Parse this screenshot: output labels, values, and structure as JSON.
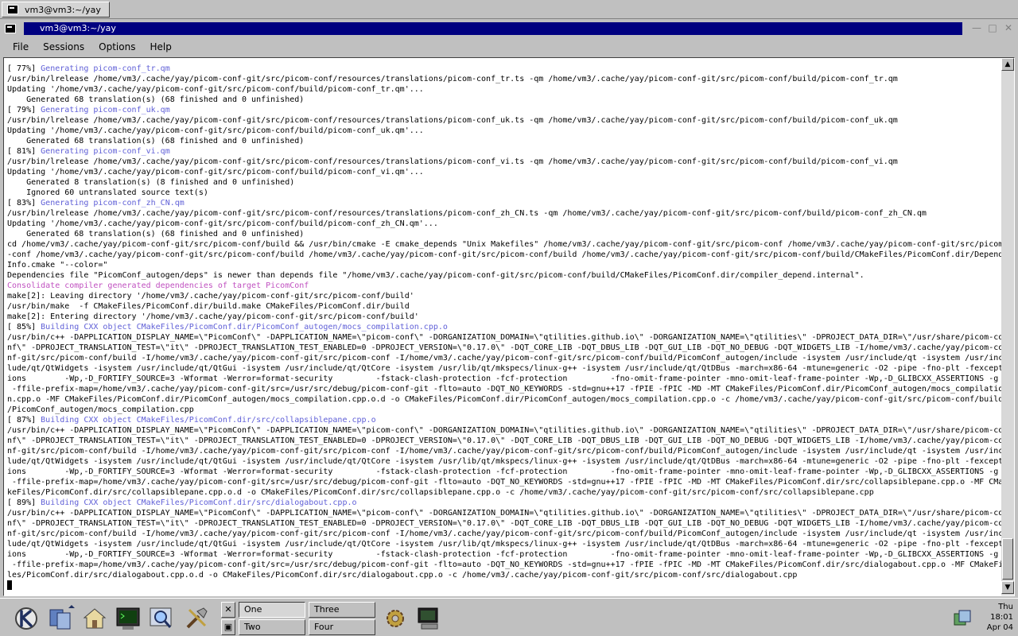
{
  "top_tab": {
    "label": "vm3@vm3:~/yay"
  },
  "window": {
    "title": "vm3@vm3:~/yay"
  },
  "menu": [
    "File",
    "Sessions",
    "Options",
    "Help"
  ],
  "terminal_lines": [
    {
      "t": "[ 77%] ",
      "h": "Generating picom-conf_tr.qm",
      "c": "blue"
    },
    {
      "t": "/usr/bin/lrelease /home/vm3/.cache/yay/picom-conf-git/src/picom-conf/resources/translations/picom-conf_tr.ts -qm /home/vm3/.cache/yay/picom-conf-git/src/picom-conf/build/picom-conf_tr.qm"
    },
    {
      "t": "Updating '/home/vm3/.cache/yay/picom-conf-git/src/picom-conf/build/picom-conf_tr.qm'..."
    },
    {
      "t": "    Generated 68 translation(s) (68 finished and 0 unfinished)"
    },
    {
      "t": "[ 79%] ",
      "h": "Generating picom-conf_uk.qm",
      "c": "blue"
    },
    {
      "t": "/usr/bin/lrelease /home/vm3/.cache/yay/picom-conf-git/src/picom-conf/resources/translations/picom-conf_uk.ts -qm /home/vm3/.cache/yay/picom-conf-git/src/picom-conf/build/picom-conf_uk.qm"
    },
    {
      "t": "Updating '/home/vm3/.cache/yay/picom-conf-git/src/picom-conf/build/picom-conf_uk.qm'..."
    },
    {
      "t": "    Generated 68 translation(s) (68 finished and 0 unfinished)"
    },
    {
      "t": "[ 81%] ",
      "h": "Generating picom-conf_vi.qm",
      "c": "blue"
    },
    {
      "t": "/usr/bin/lrelease /home/vm3/.cache/yay/picom-conf-git/src/picom-conf/resources/translations/picom-conf_vi.ts -qm /home/vm3/.cache/yay/picom-conf-git/src/picom-conf/build/picom-conf_vi.qm"
    },
    {
      "t": "Updating '/home/vm3/.cache/yay/picom-conf-git/src/picom-conf/build/picom-conf_vi.qm'..."
    },
    {
      "t": "    Generated 8 translation(s) (8 finished and 0 unfinished)"
    },
    {
      "t": "    Ignored 60 untranslated source text(s)"
    },
    {
      "t": "[ 83%] ",
      "h": "Generating picom-conf_zh_CN.qm",
      "c": "blue"
    },
    {
      "t": "/usr/bin/lrelease /home/vm3/.cache/yay/picom-conf-git/src/picom-conf/resources/translations/picom-conf_zh_CN.ts -qm /home/vm3/.cache/yay/picom-conf-git/src/picom-conf/build/picom-conf_zh_CN.qm"
    },
    {
      "t": "Updating '/home/vm3/.cache/yay/picom-conf-git/src/picom-conf/build/picom-conf_zh_CN.qm'..."
    },
    {
      "t": "    Generated 68 translation(s) (68 finished and 0 unfinished)"
    },
    {
      "t": "cd /home/vm3/.cache/yay/picom-conf-git/src/picom-conf/build && /usr/bin/cmake -E cmake_depends \"Unix Makefiles\" /home/vm3/.cache/yay/picom-conf-git/src/picom-conf /home/vm3/.cache/yay/picom-conf-git/src/picom"
    },
    {
      "t": "-conf /home/vm3/.cache/yay/picom-conf-git/src/picom-conf/build /home/vm3/.cache/yay/picom-conf-git/src/picom-conf/build /home/vm3/.cache/yay/picom-conf-git/src/picom-conf/build/CMakeFiles/PicomConf.dir/Depend"
    },
    {
      "t": "Info.cmake \"--color=\""
    },
    {
      "t": "Dependencies file \"PicomConf_autogen/deps\" is newer than depends file \"/home/vm3/.cache/yay/picom-conf-git/src/picom-conf/build/CMakeFiles/PicomConf.dir/compiler_depend.internal\"."
    },
    {
      "t": "",
      "h": "Consolidate compiler generated dependencies of target PicomConf",
      "c": "magenta"
    },
    {
      "t": "make[2]: Leaving directory '/home/vm3/.cache/yay/picom-conf-git/src/picom-conf/build'"
    },
    {
      "t": "/usr/bin/make  -f CMakeFiles/PicomConf.dir/build.make CMakeFiles/PicomConf.dir/build"
    },
    {
      "t": "make[2]: Entering directory '/home/vm3/.cache/yay/picom-conf-git/src/picom-conf/build'"
    },
    {
      "t": "[ 85%] ",
      "h": "Building CXX object CMakeFiles/PicomConf.dir/PicomConf_autogen/mocs_compilation.cpp.o",
      "c": "blue"
    },
    {
      "t": "/usr/bin/c++ -DAPPLICATION_DISPLAY_NAME=\\\"PicomConf\\\" -DAPPLICATION_NAME=\\\"picom-conf\\\" -DORGANIZATION_DOMAIN=\\\"qtilities.github.io\\\" -DORGANIZATION_NAME=\\\"qtilities\\\" -DPROJECT_DATA_DIR=\\\"/usr/share/picom-co"
    },
    {
      "t": "nf\\\" -DPROJECT_TRANSLATION_TEST=\\\"it\\\" -DPROJECT_TRANSLATION_TEST_ENABLED=0 -DPROJECT_VERSION=\\\"0.17.0\\\" -DQT_CORE_LIB -DQT_DBUS_LIB -DQT_GUI_LIB -DQT_NO_DEBUG -DQT_WIDGETS_LIB -I/home/vm3/.cache/yay/picom-co"
    },
    {
      "t": "nf-git/src/picom-conf/build -I/home/vm3/.cache/yay/picom-conf-git/src/picom-conf -I/home/vm3/.cache/yay/picom-conf-git/src/picom-conf/build/PicomConf_autogen/include -isystem /usr/include/qt -isystem /usr/inc"
    },
    {
      "t": "lude/qt/QtWidgets -isystem /usr/include/qt/QtGui -isystem /usr/include/qt/QtCore -isystem /usr/lib/qt/mkspecs/linux-g++ -isystem /usr/include/qt/QtDBus -march=x86-64 -mtune=generic -O2 -pipe -fno-plt -fexcept"
    },
    {
      "t": "ions        -Wp,-D_FORTIFY_SOURCE=3 -Wformat -Werror=format-security         -fstack-clash-protection -fcf-protection         -fno-omit-frame-pointer -mno-omit-leaf-frame-pointer -Wp,-D_GLIBCXX_ASSERTIONS -g"
    },
    {
      "t": " -ffile-prefix-map=/home/vm3/.cache/yay/picom-conf-git/src=/usr/src/debug/picom-conf-git -flto=auto -DQT_NO_KEYWORDS -std=gnu++17 -fPIE -fPIC -MD -MT CMakeFiles/PicomConf.dir/PicomConf_autogen/mocs_compilatio"
    },
    {
      "t": "n.cpp.o -MF CMakeFiles/PicomConf.dir/PicomConf_autogen/mocs_compilation.cpp.o.d -o CMakeFiles/PicomConf.dir/PicomConf_autogen/mocs_compilation.cpp.o -c /home/vm3/.cache/yay/picom-conf-git/src/picom-conf/build"
    },
    {
      "t": "/PicomConf_autogen/mocs_compilation.cpp"
    },
    {
      "t": "[ 87%] ",
      "h": "Building CXX object CMakeFiles/PicomConf.dir/src/collapsiblepane.cpp.o",
      "c": "blue"
    },
    {
      "t": "/usr/bin/c++ -DAPPLICATION_DISPLAY_NAME=\\\"PicomConf\\\" -DAPPLICATION_NAME=\\\"picom-conf\\\" -DORGANIZATION_DOMAIN=\\\"qtilities.github.io\\\" -DORGANIZATION_NAME=\\\"qtilities\\\" -DPROJECT_DATA_DIR=\\\"/usr/share/picom-co"
    },
    {
      "t": "nf\\\" -DPROJECT_TRANSLATION_TEST=\\\"it\\\" -DPROJECT_TRANSLATION_TEST_ENABLED=0 -DPROJECT_VERSION=\\\"0.17.0\\\" -DQT_CORE_LIB -DQT_DBUS_LIB -DQT_GUI_LIB -DQT_NO_DEBUG -DQT_WIDGETS_LIB -I/home/vm3/.cache/yay/picom-co"
    },
    {
      "t": "nf-git/src/picom-conf/build -I/home/vm3/.cache/yay/picom-conf-git/src/picom-conf -I/home/vm3/.cache/yay/picom-conf-git/src/picom-conf/build/PicomConf_autogen/include -isystem /usr/include/qt -isystem /usr/inc"
    },
    {
      "t": "lude/qt/QtWidgets -isystem /usr/include/qt/QtGui -isystem /usr/include/qt/QtCore -isystem /usr/lib/qt/mkspecs/linux-g++ -isystem /usr/include/qt/QtDBus -march=x86-64 -mtune=generic -O2 -pipe -fno-plt -fexcept"
    },
    {
      "t": "ions        -Wp,-D_FORTIFY_SOURCE=3 -Wformat -Werror=format-security         -fstack-clash-protection -fcf-protection         -fno-omit-frame-pointer -mno-omit-leaf-frame-pointer -Wp,-D_GLIBCXX_ASSERTIONS -g"
    },
    {
      "t": " -ffile-prefix-map=/home/vm3/.cache/yay/picom-conf-git/src=/usr/src/debug/picom-conf-git -flto=auto -DQT_NO_KEYWORDS -std=gnu++17 -fPIE -fPIC -MD -MT CMakeFiles/PicomConf.dir/src/collapsiblepane.cpp.o -MF CMa"
    },
    {
      "t": "keFiles/PicomConf.dir/src/collapsiblepane.cpp.o.d -o CMakeFiles/PicomConf.dir/src/collapsiblepane.cpp.o -c /home/vm3/.cache/yay/picom-conf-git/src/picom-conf/src/collapsiblepane.cpp"
    },
    {
      "t": "[ 89%] ",
      "h": "Building CXX object CMakeFiles/PicomConf.dir/src/dialogabout.cpp.o",
      "c": "blue"
    },
    {
      "t": "/usr/bin/c++ -DAPPLICATION_DISPLAY_NAME=\\\"PicomConf\\\" -DAPPLICATION_NAME=\\\"picom-conf\\\" -DORGANIZATION_DOMAIN=\\\"qtilities.github.io\\\" -DORGANIZATION_NAME=\\\"qtilities\\\" -DPROJECT_DATA_DIR=\\\"/usr/share/picom-co"
    },
    {
      "t": "nf\\\" -DPROJECT_TRANSLATION_TEST=\\\"it\\\" -DPROJECT_TRANSLATION_TEST_ENABLED=0 -DPROJECT_VERSION=\\\"0.17.0\\\" -DQT_CORE_LIB -DQT_DBUS_LIB -DQT_GUI_LIB -DQT_NO_DEBUG -DQT_WIDGETS_LIB -I/home/vm3/.cache/yay/picom-co"
    },
    {
      "t": "nf-git/src/picom-conf/build -I/home/vm3/.cache/yay/picom-conf-git/src/picom-conf -I/home/vm3/.cache/yay/picom-conf-git/src/picom-conf/build/PicomConf_autogen/include -isystem /usr/include/qt -isystem /usr/inc"
    },
    {
      "t": "lude/qt/QtWidgets -isystem /usr/include/qt/QtGui -isystem /usr/include/qt/QtCore -isystem /usr/lib/qt/mkspecs/linux-g++ -isystem /usr/include/qt/QtDBus -march=x86-64 -mtune=generic -O2 -pipe -fno-plt -fexcept"
    },
    {
      "t": "ions        -Wp,-D_FORTIFY_SOURCE=3 -Wformat -Werror=format-security         -fstack-clash-protection -fcf-protection         -fno-omit-frame-pointer -mno-omit-leaf-frame-pointer -Wp,-D_GLIBCXX_ASSERTIONS -g"
    },
    {
      "t": " -ffile-prefix-map=/home/vm3/.cache/yay/picom-conf-git/src=/usr/src/debug/picom-conf-git -flto=auto -DQT_NO_KEYWORDS -std=gnu++17 -fPIE -fPIC -MD -MT CMakeFiles/PicomConf.dir/src/dialogabout.cpp.o -MF CMakeFi"
    },
    {
      "t": "les/PicomConf.dir/src/dialogabout.cpp.o.d -o CMakeFiles/PicomConf.dir/src/dialogabout.cpp.o -c /home/vm3/.cache/yay/picom-conf-git/src/picom-conf/src/dialogabout.cpp"
    }
  ],
  "colors": {
    "title_active": "#000080",
    "progress_text": "#5f5fd7",
    "info_text": "#c050c0"
  },
  "panel": {
    "pager": [
      "One",
      "Two",
      "Three",
      "Four"
    ],
    "clock": {
      "day": "Thu",
      "time": "18:01",
      "date": "Apr 04"
    }
  },
  "icons": {
    "kde_menu": "kde-k-icon",
    "window_list": "window-list-icon",
    "home": "home-folder-icon",
    "terminal_launcher": "terminal-icon",
    "browser": "magnifier-browser-icon",
    "tools": "tools-icon",
    "settings": "gear-icon",
    "konsole": "konsole-icon",
    "tray": "network-tray-icon"
  }
}
